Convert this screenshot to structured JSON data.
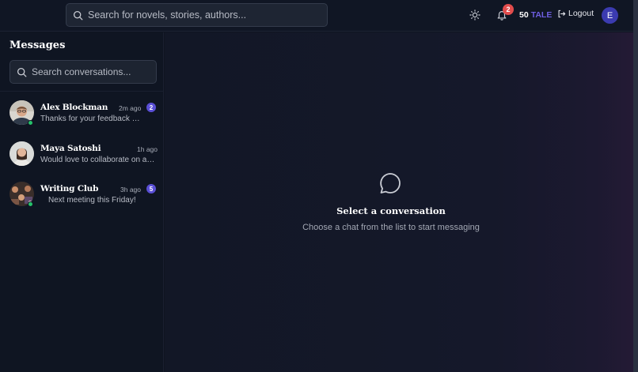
{
  "header": {
    "search_placeholder": "Search for novels, stories, authors...",
    "notification_count": "2",
    "token_amount": "50",
    "token_unit": "TALE",
    "logout_label": "Logout",
    "user_initial": "E"
  },
  "sidebar": {
    "title": "Messages",
    "search_placeholder": "Search conversations...",
    "conversations": [
      {
        "name": "Alex Blockman",
        "time": "2m ago",
        "preview": "Thanks for your feedback on my story!",
        "unread": "2",
        "online": true
      },
      {
        "name": "Maya Satoshi",
        "time": "1h ago",
        "preview": "Would love to collaborate on a sequel",
        "unread": "",
        "online": false
      },
      {
        "name": "Writing Club",
        "time": "3h ago",
        "preview": "Next meeting this Friday!",
        "unread": "5",
        "online": true
      }
    ]
  },
  "main": {
    "empty_title": "Select a conversation",
    "empty_subtitle": "Choose a chat from the list to start messaging"
  },
  "colors": {
    "accent": "#5a4fd6",
    "notification": "#e24c4c",
    "online": "#25c26a",
    "token_unit": "#6d5ee0"
  }
}
